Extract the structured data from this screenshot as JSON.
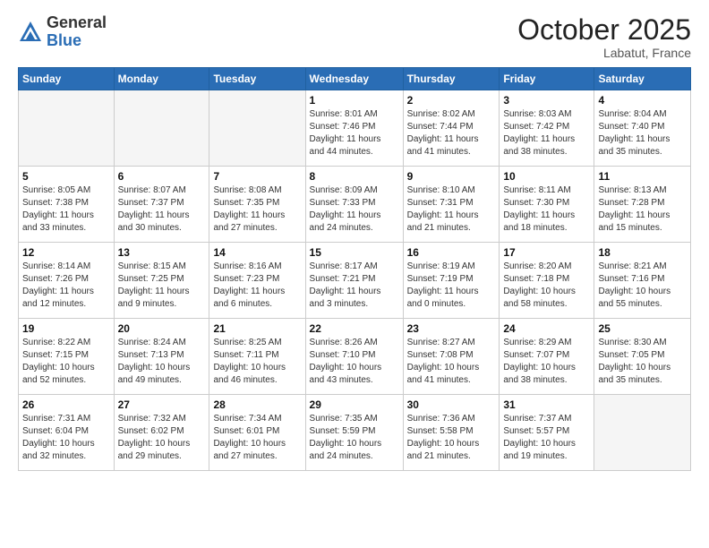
{
  "header": {
    "logo_general": "General",
    "logo_blue": "Blue",
    "month_title": "October 2025",
    "location": "Labatut, France"
  },
  "days_of_week": [
    "Sunday",
    "Monday",
    "Tuesday",
    "Wednesday",
    "Thursday",
    "Friday",
    "Saturday"
  ],
  "weeks": [
    [
      {
        "day": "",
        "info": ""
      },
      {
        "day": "",
        "info": ""
      },
      {
        "day": "",
        "info": ""
      },
      {
        "day": "1",
        "info": "Sunrise: 8:01 AM\nSunset: 7:46 PM\nDaylight: 11 hours\nand 44 minutes."
      },
      {
        "day": "2",
        "info": "Sunrise: 8:02 AM\nSunset: 7:44 PM\nDaylight: 11 hours\nand 41 minutes."
      },
      {
        "day": "3",
        "info": "Sunrise: 8:03 AM\nSunset: 7:42 PM\nDaylight: 11 hours\nand 38 minutes."
      },
      {
        "day": "4",
        "info": "Sunrise: 8:04 AM\nSunset: 7:40 PM\nDaylight: 11 hours\nand 35 minutes."
      }
    ],
    [
      {
        "day": "5",
        "info": "Sunrise: 8:05 AM\nSunset: 7:38 PM\nDaylight: 11 hours\nand 33 minutes."
      },
      {
        "day": "6",
        "info": "Sunrise: 8:07 AM\nSunset: 7:37 PM\nDaylight: 11 hours\nand 30 minutes."
      },
      {
        "day": "7",
        "info": "Sunrise: 8:08 AM\nSunset: 7:35 PM\nDaylight: 11 hours\nand 27 minutes."
      },
      {
        "day": "8",
        "info": "Sunrise: 8:09 AM\nSunset: 7:33 PM\nDaylight: 11 hours\nand 24 minutes."
      },
      {
        "day": "9",
        "info": "Sunrise: 8:10 AM\nSunset: 7:31 PM\nDaylight: 11 hours\nand 21 minutes."
      },
      {
        "day": "10",
        "info": "Sunrise: 8:11 AM\nSunset: 7:30 PM\nDaylight: 11 hours\nand 18 minutes."
      },
      {
        "day": "11",
        "info": "Sunrise: 8:13 AM\nSunset: 7:28 PM\nDaylight: 11 hours\nand 15 minutes."
      }
    ],
    [
      {
        "day": "12",
        "info": "Sunrise: 8:14 AM\nSunset: 7:26 PM\nDaylight: 11 hours\nand 12 minutes."
      },
      {
        "day": "13",
        "info": "Sunrise: 8:15 AM\nSunset: 7:25 PM\nDaylight: 11 hours\nand 9 minutes."
      },
      {
        "day": "14",
        "info": "Sunrise: 8:16 AM\nSunset: 7:23 PM\nDaylight: 11 hours\nand 6 minutes."
      },
      {
        "day": "15",
        "info": "Sunrise: 8:17 AM\nSunset: 7:21 PM\nDaylight: 11 hours\nand 3 minutes."
      },
      {
        "day": "16",
        "info": "Sunrise: 8:19 AM\nSunset: 7:19 PM\nDaylight: 11 hours\nand 0 minutes."
      },
      {
        "day": "17",
        "info": "Sunrise: 8:20 AM\nSunset: 7:18 PM\nDaylight: 10 hours\nand 58 minutes."
      },
      {
        "day": "18",
        "info": "Sunrise: 8:21 AM\nSunset: 7:16 PM\nDaylight: 10 hours\nand 55 minutes."
      }
    ],
    [
      {
        "day": "19",
        "info": "Sunrise: 8:22 AM\nSunset: 7:15 PM\nDaylight: 10 hours\nand 52 minutes."
      },
      {
        "day": "20",
        "info": "Sunrise: 8:24 AM\nSunset: 7:13 PM\nDaylight: 10 hours\nand 49 minutes."
      },
      {
        "day": "21",
        "info": "Sunrise: 8:25 AM\nSunset: 7:11 PM\nDaylight: 10 hours\nand 46 minutes."
      },
      {
        "day": "22",
        "info": "Sunrise: 8:26 AM\nSunset: 7:10 PM\nDaylight: 10 hours\nand 43 minutes."
      },
      {
        "day": "23",
        "info": "Sunrise: 8:27 AM\nSunset: 7:08 PM\nDaylight: 10 hours\nand 41 minutes."
      },
      {
        "day": "24",
        "info": "Sunrise: 8:29 AM\nSunset: 7:07 PM\nDaylight: 10 hours\nand 38 minutes."
      },
      {
        "day": "25",
        "info": "Sunrise: 8:30 AM\nSunset: 7:05 PM\nDaylight: 10 hours\nand 35 minutes."
      }
    ],
    [
      {
        "day": "26",
        "info": "Sunrise: 7:31 AM\nSunset: 6:04 PM\nDaylight: 10 hours\nand 32 minutes."
      },
      {
        "day": "27",
        "info": "Sunrise: 7:32 AM\nSunset: 6:02 PM\nDaylight: 10 hours\nand 29 minutes."
      },
      {
        "day": "28",
        "info": "Sunrise: 7:34 AM\nSunset: 6:01 PM\nDaylight: 10 hours\nand 27 minutes."
      },
      {
        "day": "29",
        "info": "Sunrise: 7:35 AM\nSunset: 5:59 PM\nDaylight: 10 hours\nand 24 minutes."
      },
      {
        "day": "30",
        "info": "Sunrise: 7:36 AM\nSunset: 5:58 PM\nDaylight: 10 hours\nand 21 minutes."
      },
      {
        "day": "31",
        "info": "Sunrise: 7:37 AM\nSunset: 5:57 PM\nDaylight: 10 hours\nand 19 minutes."
      },
      {
        "day": "",
        "info": ""
      }
    ]
  ]
}
